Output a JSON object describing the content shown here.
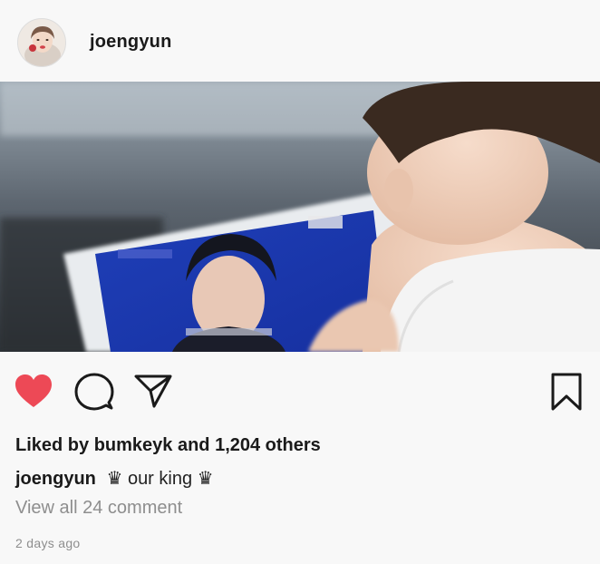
{
  "post": {
    "username": "joengyun",
    "avatar_icon": "profile-avatar",
    "photo_icon": "photo-child-watching-tablet",
    "actions": {
      "like_icon": "heart-filled-icon",
      "like_color": "#ed4956",
      "comment_icon": "comment-icon",
      "share_icon": "paper-plane-icon",
      "save_icon": "bookmark-icon"
    },
    "likes_text": "Liked by bumkeyk and 1,204 others",
    "caption": {
      "username": "joengyun",
      "text": "♛ our king ♛"
    },
    "view_comments": "View all 24 comment",
    "timestamp": "2 days ago"
  }
}
